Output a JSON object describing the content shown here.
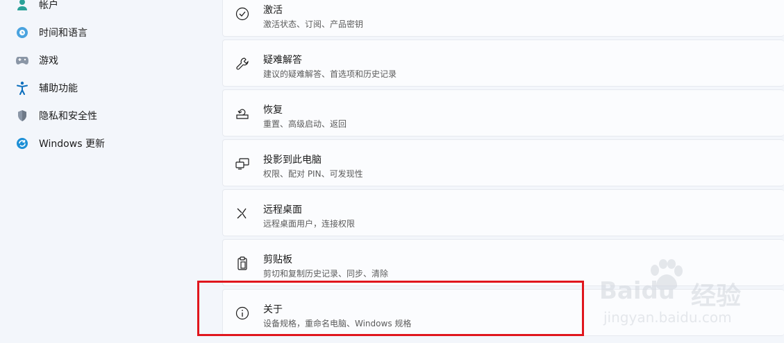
{
  "sidebar": {
    "items": [
      {
        "label": "帐户",
        "icon": "account-icon"
      },
      {
        "label": "时间和语言",
        "icon": "time-language-icon"
      },
      {
        "label": "游戏",
        "icon": "gaming-icon"
      },
      {
        "label": "辅助功能",
        "icon": "accessibility-icon"
      },
      {
        "label": "隐私和安全性",
        "icon": "privacy-shield-icon"
      },
      {
        "label": "Windows 更新",
        "icon": "windows-update-icon"
      }
    ]
  },
  "main": {
    "cards": [
      {
        "title": "激活",
        "subtitle": "激活状态、订阅、产品密钥",
        "icon": "activation-check-icon"
      },
      {
        "title": "疑难解答",
        "subtitle": "建议的疑难解答、首选项和历史记录",
        "icon": "wrench-icon"
      },
      {
        "title": "恢复",
        "subtitle": "重置、高级启动、返回",
        "icon": "recovery-icon"
      },
      {
        "title": "投影到此电脑",
        "subtitle": "权限、配对 PIN、可发现性",
        "icon": "projection-icon"
      },
      {
        "title": "远程桌面",
        "subtitle": "远程桌面用户，连接权限",
        "icon": "remote-desktop-icon"
      },
      {
        "title": "剪贴板",
        "subtitle": "剪切和复制历史记录、同步、清除",
        "icon": "clipboard-icon"
      },
      {
        "title": "关于",
        "subtitle": "设备规格，重命名电脑、Windows 规格",
        "icon": "info-icon"
      }
    ]
  },
  "watermark": {
    "brand": "Baidu",
    "cn": "经验",
    "url": "jingyan.baidu.com"
  },
  "colors": {
    "highlight": "#e0161d",
    "accent": "#0067c0"
  }
}
